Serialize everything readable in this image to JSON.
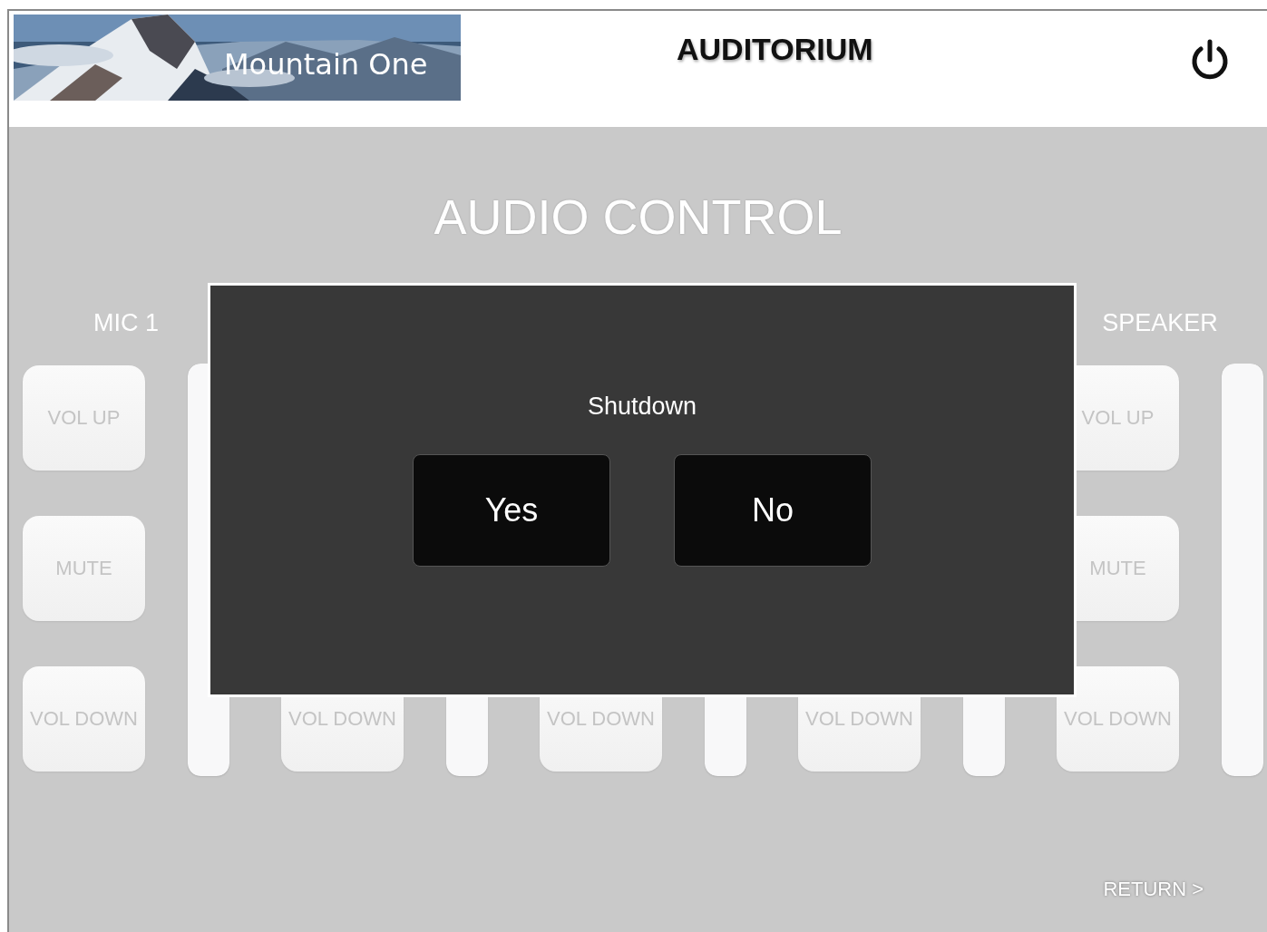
{
  "header": {
    "logo_text": "Mountain One",
    "title": "AUDITORIUM"
  },
  "page_title": "AUDIO CONTROL",
  "channels": [
    {
      "kind": "open",
      "name": "MIC 1",
      "level": 1,
      "buttons": [
        "VOL UP",
        "MUTE",
        "VOL DOWN"
      ]
    },
    {
      "kind": "covered",
      "level": 1,
      "buttons": [
        "VOL DOWN"
      ]
    },
    {
      "kind": "covered",
      "level": 1,
      "buttons": [
        "VOL DOWN"
      ]
    },
    {
      "kind": "covered",
      "level": 1,
      "buttons": [
        "VOL DOWN"
      ]
    },
    {
      "kind": "open",
      "name": "SPEAKER",
      "level": 1,
      "buttons": [
        "VOL UP",
        "MUTE",
        "VOL DOWN"
      ]
    }
  ],
  "dialog": {
    "title": "Shutdown",
    "buttons": [
      "Yes",
      "No"
    ]
  },
  "return_link": "RETURN >"
}
